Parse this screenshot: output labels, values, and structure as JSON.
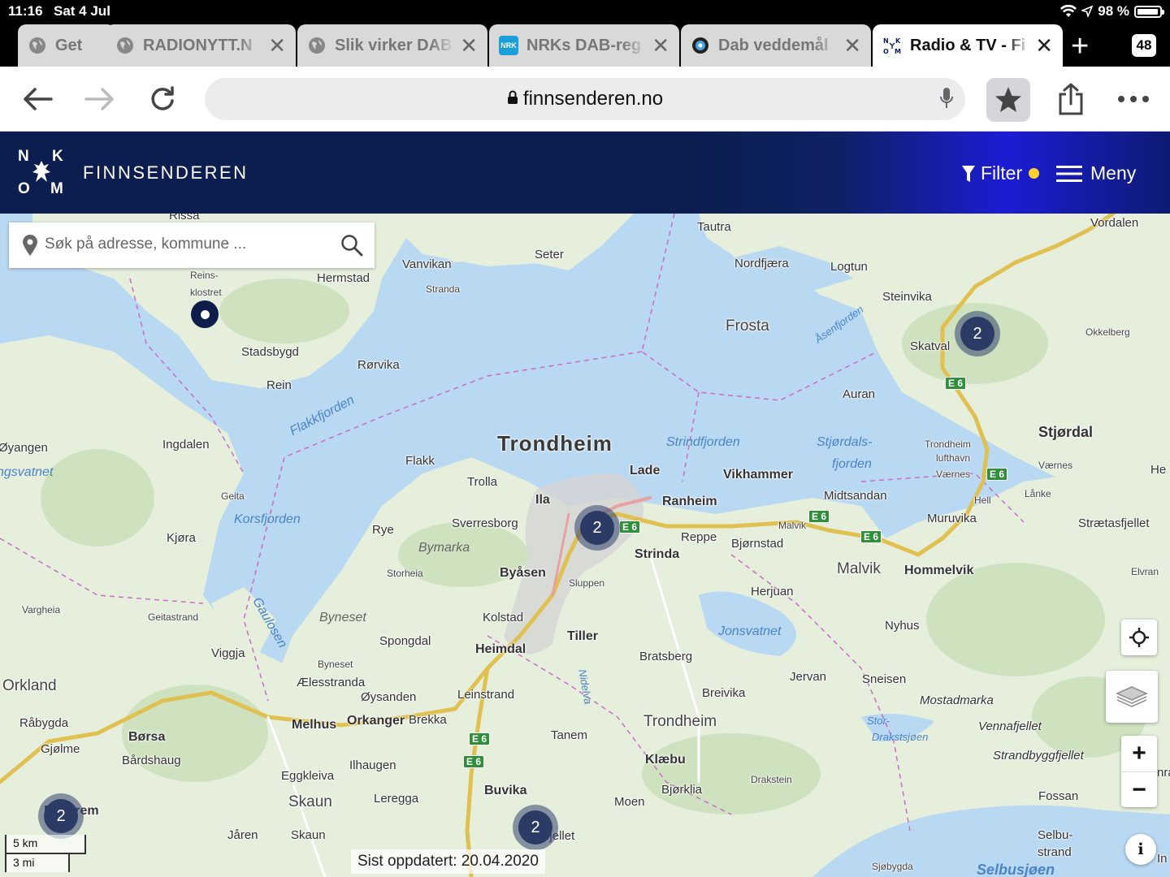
{
  "status_bar": {
    "time": "11:16",
    "date": "Sat 4 Jul",
    "battery": "98 %"
  },
  "tabs": [
    {
      "title": "Get",
      "icon": "globe-icon"
    },
    {
      "title": "RADIONYTT.N",
      "icon": "globe-icon"
    },
    {
      "title": "Slik virker DAB",
      "icon": "globe-icon"
    },
    {
      "title": "NRKs DAB-reg",
      "icon": "nrk-icon",
      "icon_text": "NRK"
    },
    {
      "title": "Dab veddemål",
      "icon": "disc-icon"
    },
    {
      "title": "Radio & TV - Fi",
      "icon": "nkom-icon",
      "active": true
    }
  ],
  "tab_count": "48",
  "url": "finnsenderen.no",
  "site": {
    "logo_letters": [
      "N",
      "K",
      "O",
      "M"
    ],
    "title": "FINNSENDEREN",
    "filter_label": "Filter",
    "menu_label": "Meny"
  },
  "search": {
    "placeholder": "Søk på adresse, kommune ..."
  },
  "map": {
    "places": [
      {
        "label": "Trondheim",
        "style": "big"
      },
      {
        "label": "Frosta",
        "style": "med"
      },
      {
        "label": "Malvik",
        "style": "med"
      },
      {
        "label": "Orkland",
        "style": "med"
      },
      {
        "label": "Trondheim",
        "style": "med"
      },
      {
        "label": "Skaun",
        "style": "med"
      },
      {
        "label": "Stjørdal",
        "style": "bold"
      },
      {
        "label": "Hommelvik",
        "style": "bold"
      },
      {
        "label": "Lade",
        "style": "bold"
      },
      {
        "label": "Vikhammer",
        "style": "bold"
      },
      {
        "label": "Ranheim",
        "style": "bold"
      },
      {
        "label": "Strinda",
        "style": "bold"
      },
      {
        "label": "Byåsen",
        "style": "bold"
      },
      {
        "label": "Tiller",
        "style": "bold"
      },
      {
        "label": "Heimdal",
        "style": "bold"
      },
      {
        "label": "Klæbu",
        "style": "bold"
      },
      {
        "label": "Melhus",
        "style": "bold"
      },
      {
        "label": "Orkanger",
        "style": "bold"
      },
      {
        "label": "Børsa",
        "style": "bold"
      },
      {
        "label": "Buvika",
        "style": "bold"
      },
      {
        "label": "Ila",
        "style": "bold"
      },
      {
        "label": "Rissa",
        "style": "normal"
      },
      {
        "label": "Tautra",
        "style": "normal"
      },
      {
        "label": "Vordalen",
        "style": "normal"
      },
      {
        "label": "Seter",
        "style": "normal"
      },
      {
        "label": "Vanvikan",
        "style": "normal"
      },
      {
        "label": "Hermstad",
        "style": "normal"
      },
      {
        "label": "Nordfjæra",
        "style": "normal"
      },
      {
        "label": "Logtun",
        "style": "normal"
      },
      {
        "label": "Steinvika",
        "style": "normal"
      },
      {
        "label": "Stranda",
        "style": "small"
      },
      {
        "label": "Reins-",
        "style": "small"
      },
      {
        "label": "klostret",
        "style": "small"
      },
      {
        "label": "Stadsbygd",
        "style": "normal"
      },
      {
        "label": "Rørvika",
        "style": "normal"
      },
      {
        "label": "Rein",
        "style": "normal"
      },
      {
        "label": "Skatval",
        "style": "normal"
      },
      {
        "label": "Okkelberg",
        "style": "small"
      },
      {
        "label": "Auran",
        "style": "normal"
      },
      {
        "label": "Øyangen",
        "style": "normal"
      },
      {
        "label": "Ingdalen",
        "style": "normal"
      },
      {
        "label": "Flakk",
        "style": "normal"
      },
      {
        "label": "Trolla",
        "style": "normal"
      },
      {
        "label": "Trondheim",
        "style": "small"
      },
      {
        "label": "lufthavn",
        "style": "small"
      },
      {
        "label": "Værnes",
        "style": "small"
      },
      {
        "label": "Værnes",
        "style": "small"
      },
      {
        "label": "He",
        "style": "normal"
      },
      {
        "label": "Geita",
        "style": "small"
      },
      {
        "label": "Midtsandan",
        "style": "normal"
      },
      {
        "label": "Hell",
        "style": "small"
      },
      {
        "label": "Lånke",
        "style": "small"
      },
      {
        "label": "Sverresborg",
        "style": "normal"
      },
      {
        "label": "Kjøra",
        "style": "normal"
      },
      {
        "label": "Rye",
        "style": "normal"
      },
      {
        "label": "Reppe",
        "style": "normal"
      },
      {
        "label": "Malvik",
        "style": "small"
      },
      {
        "label": "Bjørnstad",
        "style": "normal"
      },
      {
        "label": "Muruvika",
        "style": "normal"
      },
      {
        "label": "Strætasfjellet",
        "style": "normal"
      },
      {
        "label": "Storheia",
        "style": "small"
      },
      {
        "label": "Sluppen",
        "style": "small"
      },
      {
        "label": "Herjuan",
        "style": "normal"
      },
      {
        "label": "Elvran",
        "style": "small"
      },
      {
        "label": "Vargheia",
        "style": "small"
      },
      {
        "label": "Geitastrand",
        "style": "small"
      },
      {
        "label": "Kolstad",
        "style": "normal"
      },
      {
        "label": "Nyhus",
        "style": "normal"
      },
      {
        "label": "Viggja",
        "style": "normal"
      },
      {
        "label": "Spongdal",
        "style": "normal"
      },
      {
        "label": "Bratsberg",
        "style": "normal"
      },
      {
        "label": "Byneset",
        "style": "small"
      },
      {
        "label": "Jervan",
        "style": "normal"
      },
      {
        "label": "Sneisen",
        "style": "normal"
      },
      {
        "label": "Ælesstranda",
        "style": "normal"
      },
      {
        "label": "Leinstrand",
        "style": "normal"
      },
      {
        "label": "Breivika",
        "style": "normal"
      },
      {
        "label": "Mostadmarka",
        "style": "normal"
      },
      {
        "label": "Øysanden",
        "style": "normal"
      },
      {
        "label": "Råbygda",
        "style": "normal"
      },
      {
        "label": "Brekka",
        "style": "normal"
      },
      {
        "label": "Vennafjellet",
        "style": "normal"
      },
      {
        "label": "Gjølme",
        "style": "normal"
      },
      {
        "label": "Bårdshaug",
        "style": "normal"
      },
      {
        "label": "Tanem",
        "style": "normal"
      },
      {
        "label": "Strandbyggfjellet",
        "style": "normal"
      },
      {
        "label": "Ilhaugen",
        "style": "normal"
      },
      {
        "label": "Eggkleiva",
        "style": "normal"
      },
      {
        "label": "Drakstein",
        "style": "small"
      },
      {
        "label": "Bjørklia",
        "style": "normal"
      },
      {
        "label": "Fossan",
        "style": "normal"
      },
      {
        "label": "Lereggа",
        "style": "normal"
      },
      {
        "label": "Moen",
        "style": "normal"
      },
      {
        "label": "Fannrem",
        "style": "bold"
      },
      {
        "label": "Jåren",
        "style": "normal"
      },
      {
        "label": "Skaun",
        "style": "normal"
      },
      {
        "label": "Selbu-",
        "style": "normal"
      },
      {
        "label": "strand",
        "style": "normal"
      },
      {
        "label": "Sjøbygda",
        "style": "small"
      },
      {
        "label": "In",
        "style": "normal"
      },
      {
        "label": "Vassfjellet",
        "style": "normal"
      },
      {
        "label": "nra",
        "style": "normal"
      }
    ],
    "water_labels": [
      "Flakkfjorden",
      "Strindfjorden",
      "Stjørdals-",
      "fjorden",
      "Korsfjorden",
      "Gaulosen",
      "Bymarka",
      "Byneset",
      "Jonsvatnet",
      "Stor-",
      "Drakstsjøen",
      "Selbusjøen",
      "Åsenfjorden",
      "Nidelva",
      "ngsvatnet"
    ],
    "road_badge": "E 6",
    "clusters": [
      "2",
      "2",
      "2",
      "2"
    ],
    "scale": {
      "km": "5 km",
      "mi": "3 mi"
    },
    "updated": "Sist oppdatert: 20.04.2020"
  },
  "colors": {
    "header": "#0b1e4f",
    "filter_dot": "#ffd230",
    "water": "#b9d8f2",
    "land": "#e8f0df",
    "cluster": "#2c3a66"
  }
}
